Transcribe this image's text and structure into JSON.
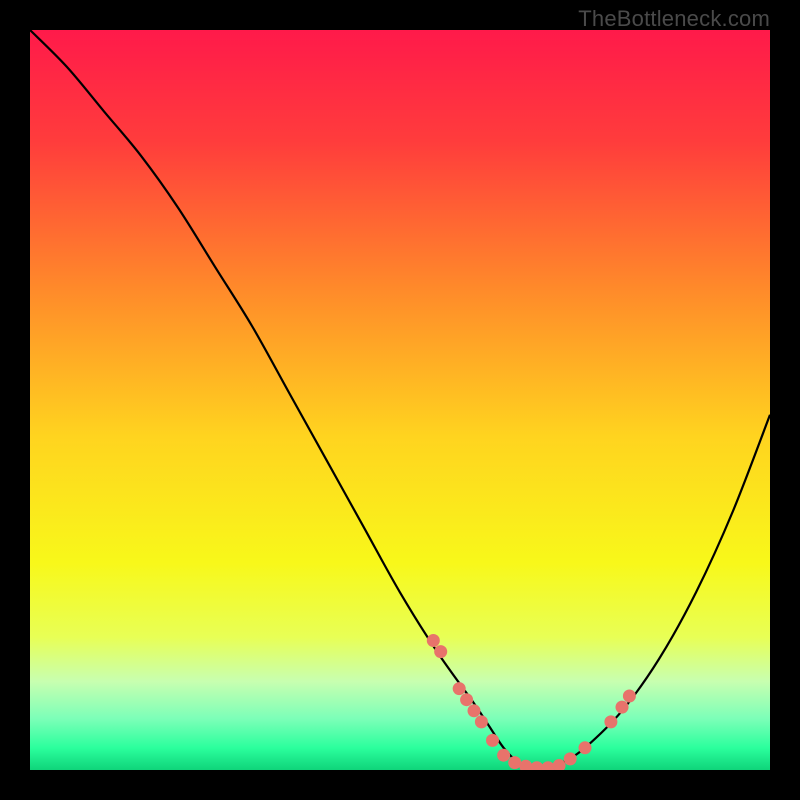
{
  "watermark": "TheBottleneck.com",
  "chart_data": {
    "type": "line",
    "title": "",
    "xlabel": "",
    "ylabel": "",
    "xlim": [
      0,
      100
    ],
    "ylim": [
      0,
      100
    ],
    "series": [
      {
        "name": "curve",
        "x": [
          0,
          5,
          10,
          15,
          20,
          25,
          30,
          35,
          40,
          45,
          50,
          55,
          60,
          62,
          64,
          66,
          68,
          70,
          72,
          75,
          80,
          85,
          90,
          95,
          100
        ],
        "y": [
          100,
          95,
          89,
          83,
          76,
          68,
          60,
          51,
          42,
          33,
          24,
          16,
          9,
          6,
          3,
          1,
          0,
          0,
          1,
          3,
          8,
          15,
          24,
          35,
          48
        ]
      }
    ],
    "markers": {
      "name": "dots",
      "color": "#e8736b",
      "x": [
        54.5,
        55.5,
        58.0,
        59.0,
        60.0,
        61.0,
        62.5,
        64.0,
        65.5,
        67.0,
        68.5,
        70.0,
        71.5,
        73.0,
        75.0,
        78.5,
        80.0,
        81.0
      ],
      "y": [
        17.5,
        16.0,
        11.0,
        9.5,
        8.0,
        6.5,
        4.0,
        2.0,
        1.0,
        0.5,
        0.3,
        0.3,
        0.6,
        1.5,
        3.0,
        6.5,
        8.5,
        10.0
      ]
    },
    "gradient_stops": [
      {
        "offset": 0,
        "color": "#ff1a4a"
      },
      {
        "offset": 15,
        "color": "#ff3c3c"
      },
      {
        "offset": 35,
        "color": "#ff8a2a"
      },
      {
        "offset": 55,
        "color": "#ffd41f"
      },
      {
        "offset": 72,
        "color": "#f8f81a"
      },
      {
        "offset": 82,
        "color": "#e8ff55"
      },
      {
        "offset": 88,
        "color": "#c8ffb0"
      },
      {
        "offset": 93,
        "color": "#7dffb8"
      },
      {
        "offset": 97,
        "color": "#2bff9d"
      },
      {
        "offset": 100,
        "color": "#0fd47a"
      }
    ]
  }
}
